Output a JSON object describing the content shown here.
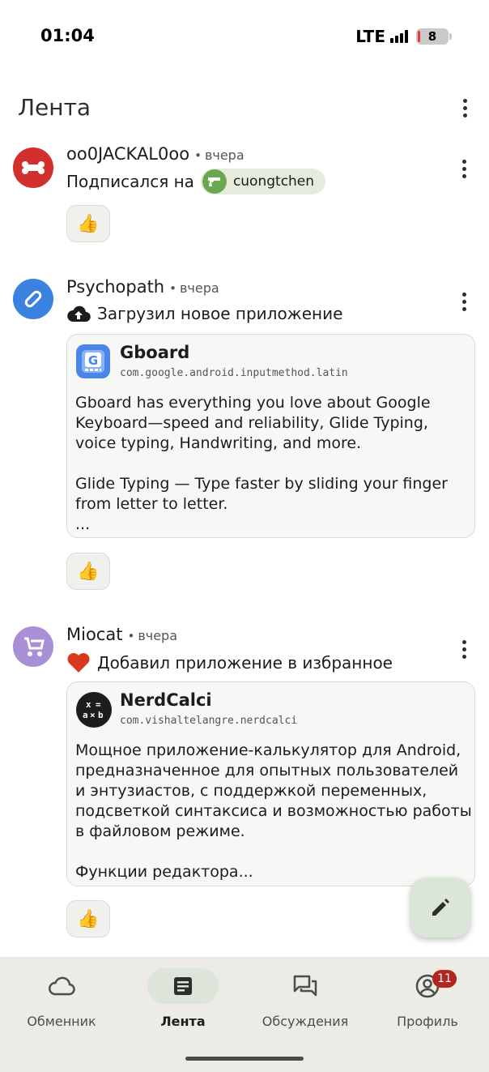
{
  "status_bar": {
    "time": "01:04",
    "network": "LTE",
    "battery": "8"
  },
  "header": {
    "title": "Лента",
    "menu_icon": "more-vert-icon"
  },
  "feed": [
    {
      "user": "oo0JACKAL0oo",
      "time": "вчера",
      "avatar_color": "#d32f2f",
      "avatar_icon": "bone-icon",
      "action": "Подписался на",
      "target_user": "cuongtchen",
      "reaction_icon": "thumbs-up-icon",
      "reaction": "👍"
    },
    {
      "user": "Psychopath",
      "time": "вчера",
      "avatar_color": "#3b82e0",
      "avatar_icon": "pill-icon",
      "action_icon": "cloud-upload-icon",
      "action": "Загрузил новое приложение",
      "app": {
        "name": "Gboard",
        "package": "com.google.android.inputmethod.latin",
        "description": "Gboard has everything you love about Google Keyboard—speed and reliability, Glide Typing, voice typing, Handwriting, and more.\n\nGlide Typing — Type faster by sliding your finger from letter to letter.\n..."
      },
      "reaction_icon": "thumbs-up-icon",
      "reaction": "👍"
    },
    {
      "user": "Miocat",
      "time": "вчера",
      "avatar_color": "#a98fd6",
      "avatar_icon": "stroller-icon",
      "action_icon": "heart-icon",
      "action": "Добавил приложение в избранное",
      "app": {
        "name": "NerdCalci",
        "package": "com.vishaltelangre.nerdcalci",
        "description": "Мощное приложение-калькулятор для Android, предназначенное для опытных пользователей и энтузиастов, с поддержкой переменных, подсветкой синтаксиса и возможностью работы в файловом режиме.\n\nФункции редактора..."
      },
      "reaction_icon": "thumbs-up-icon",
      "reaction": "👍"
    }
  ],
  "fab": {
    "icon": "edit-pencil-icon"
  },
  "bottom_nav": {
    "items": [
      {
        "label": "Обменник",
        "icon": "cloud-icon",
        "active": false
      },
      {
        "label": "Лента",
        "icon": "feed-icon",
        "active": true
      },
      {
        "label": "Обсуждения",
        "icon": "chat-icon",
        "active": false
      },
      {
        "label": "Профиль",
        "icon": "account-icon",
        "active": false,
        "badge": "11"
      }
    ]
  }
}
